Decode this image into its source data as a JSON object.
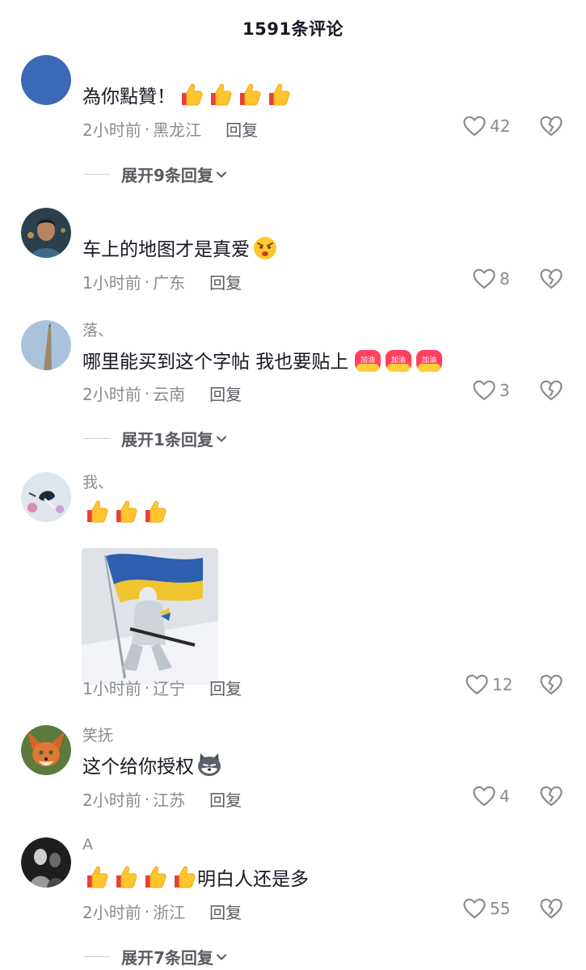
{
  "header": {
    "title": "1591条评论"
  },
  "reply_label": "回复",
  "comments": [
    {
      "username": "",
      "text": "為你點贊！",
      "time": "2小时前",
      "location": "黑龙江",
      "likes": "42",
      "expand": "展开9条回复",
      "emojis": [
        "thumbs-up",
        "thumbs-up",
        "thumbs-up",
        "thumbs-up"
      ]
    },
    {
      "username": "",
      "text": "车上的地图才是真爱",
      "time": "1小时前",
      "location": "广东",
      "likes": "8",
      "emojis": [
        "angry-face"
      ]
    },
    {
      "username": "落、",
      "text": "哪里能买到这个字帖 我也要贴上",
      "time": "2小时前",
      "location": "云南",
      "likes": "3",
      "expand": "展开1条回复",
      "emojis": [
        "jiayou-sticker",
        "jiayou-sticker",
        "jiayou-sticker"
      ],
      "sticker_text": "加油"
    },
    {
      "username": "我、",
      "text": "",
      "time": "1小时前",
      "location": "辽宁",
      "likes": "12",
      "emojis": [
        "thumbs-up",
        "thumbs-up",
        "thumbs-up"
      ],
      "image": "soldier-with-flag-image"
    },
    {
      "username": "笑抚",
      "text": "这个给你授权",
      "time": "2小时前",
      "location": "江苏",
      "likes": "4",
      "emojis": [
        "husky-emoji"
      ]
    },
    {
      "username": "A",
      "text": "明白人还是多",
      "time": "2小时前",
      "location": "浙江",
      "likes": "55",
      "expand": "展开7条回复",
      "emojis": [
        "thumbs-up",
        "thumbs-up",
        "thumbs-up",
        "thumbs-up"
      ]
    }
  ],
  "meta_separator": "·",
  "colors": {
    "text": "#161823",
    "muted": "#8a8b91",
    "reply": "#5a5b62"
  }
}
